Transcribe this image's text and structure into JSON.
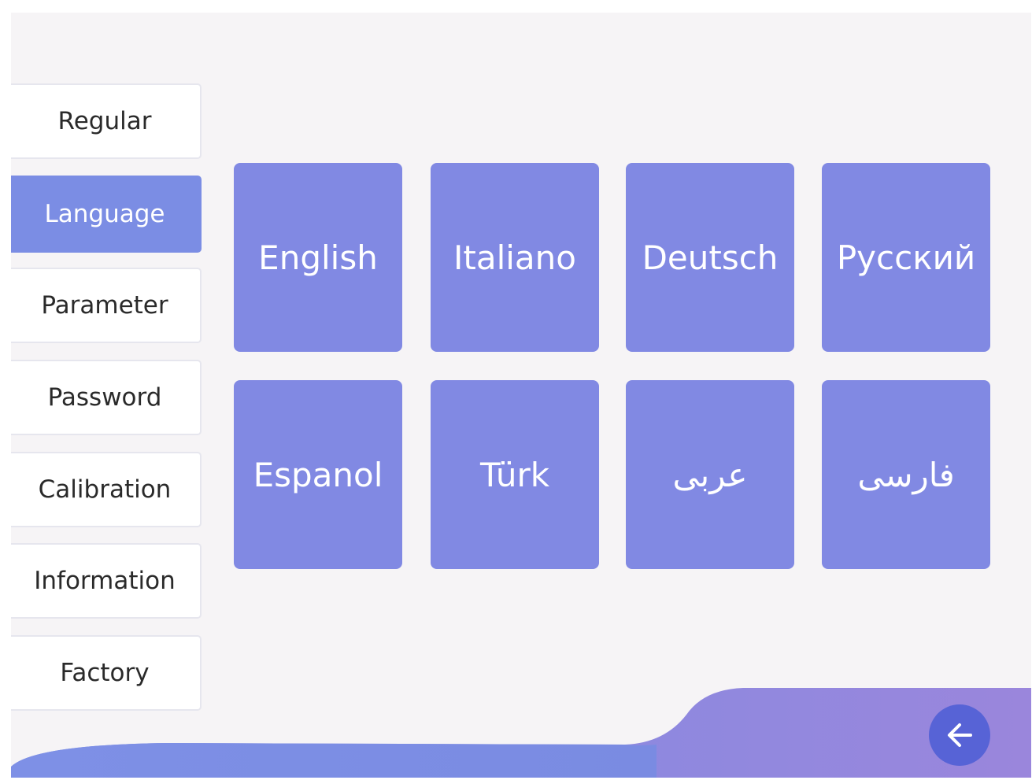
{
  "sidebar": {
    "items": [
      {
        "label": "Regular",
        "active": false
      },
      {
        "label": "Language",
        "active": true
      },
      {
        "label": "Parameter",
        "active": false
      },
      {
        "label": "Password",
        "active": false
      },
      {
        "label": "Calibration",
        "active": false
      },
      {
        "label": "Information",
        "active": false
      },
      {
        "label": "Factory",
        "active": false
      }
    ]
  },
  "languages": [
    {
      "label": "English"
    },
    {
      "label": "Italiano"
    },
    {
      "label": "Deutsch"
    },
    {
      "label": "Русский"
    },
    {
      "label": "Espanol"
    },
    {
      "label": "Türk"
    },
    {
      "label": "عربی"
    },
    {
      "label": "فارسی"
    }
  ],
  "footer": {
    "back_icon": "arrow-left-icon"
  },
  "colors": {
    "accent": "#7b8de4",
    "tile": "#8189e3",
    "back_button": "#5763d6",
    "background": "#f6f4f6"
  }
}
